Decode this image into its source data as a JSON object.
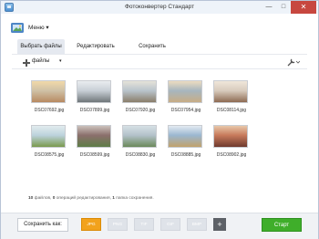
{
  "window": {
    "title": "Фотоконвертер Стандарт"
  },
  "menu": {
    "label": "Меню ▾"
  },
  "tabs": [
    {
      "label": "Выбрать файлы",
      "active": true
    },
    {
      "label": "Редактировать",
      "active": false
    },
    {
      "label": "Сохранить",
      "active": false
    }
  ],
  "toolbar": {
    "add_label": "файлы",
    "add_caret": "▾"
  },
  "files": [
    {
      "name": "DSC07692.jpg",
      "colors": [
        "#cfc1a6",
        "#b88a62",
        "#f1d9a9"
      ]
    },
    {
      "name": "DSC07899.jpg",
      "colors": [
        "#c8cfd6",
        "#6f7679",
        "#e9ecef"
      ]
    },
    {
      "name": "DSC07920.jpg",
      "colors": [
        "#b9c4cc",
        "#8a7e6a",
        "#e5e2d9"
      ]
    },
    {
      "name": "DSC07954.jpg",
      "colors": [
        "#a7b6bf",
        "#c8ad86",
        "#ecdcc0"
      ]
    },
    {
      "name": "DSC08114.jpg",
      "colors": [
        "#d8cbbd",
        "#8e6b53",
        "#efe6da"
      ]
    },
    {
      "name": "DSC08575.jpg",
      "colors": [
        "#bcd2dc",
        "#7a9a4d",
        "#e2ecee"
      ]
    },
    {
      "name": "DSC08599.jpg",
      "colors": [
        "#8b6f6c",
        "#5e7d47",
        "#cbc1bb"
      ]
    },
    {
      "name": "DSC08830.jpg",
      "colors": [
        "#b3c1ca",
        "#6b8a5b",
        "#d6e0e5"
      ]
    },
    {
      "name": "DSC08885.jpg",
      "colors": [
        "#9bb7d0",
        "#c2a26b",
        "#e3ebf2"
      ]
    },
    {
      "name": "DSC08902.jpg",
      "colors": [
        "#c77a5b",
        "#6e3a2e",
        "#e8c7a9"
      ]
    }
  ],
  "status": {
    "files_count": "10",
    "files_word": " файлов, ",
    "edits_count": "0",
    "edits_word": " операций редактирования, ",
    "folders_count": "1",
    "folders_word": " папка сохранения."
  },
  "bottom": {
    "saveas_label": "Сохранить как:",
    "formats": [
      {
        "label": "JPG",
        "active": true
      },
      {
        "label": "PNG",
        "active": false
      },
      {
        "label": "TIF",
        "active": false
      },
      {
        "label": "GIF",
        "active": false
      },
      {
        "label": "BMP",
        "active": false
      }
    ],
    "add_format_label": "+",
    "start_label": "Старт"
  },
  "colors": {
    "accent_format": "#f2a21c",
    "start_button": "#3fae2a",
    "close_button": "#c7473f"
  }
}
